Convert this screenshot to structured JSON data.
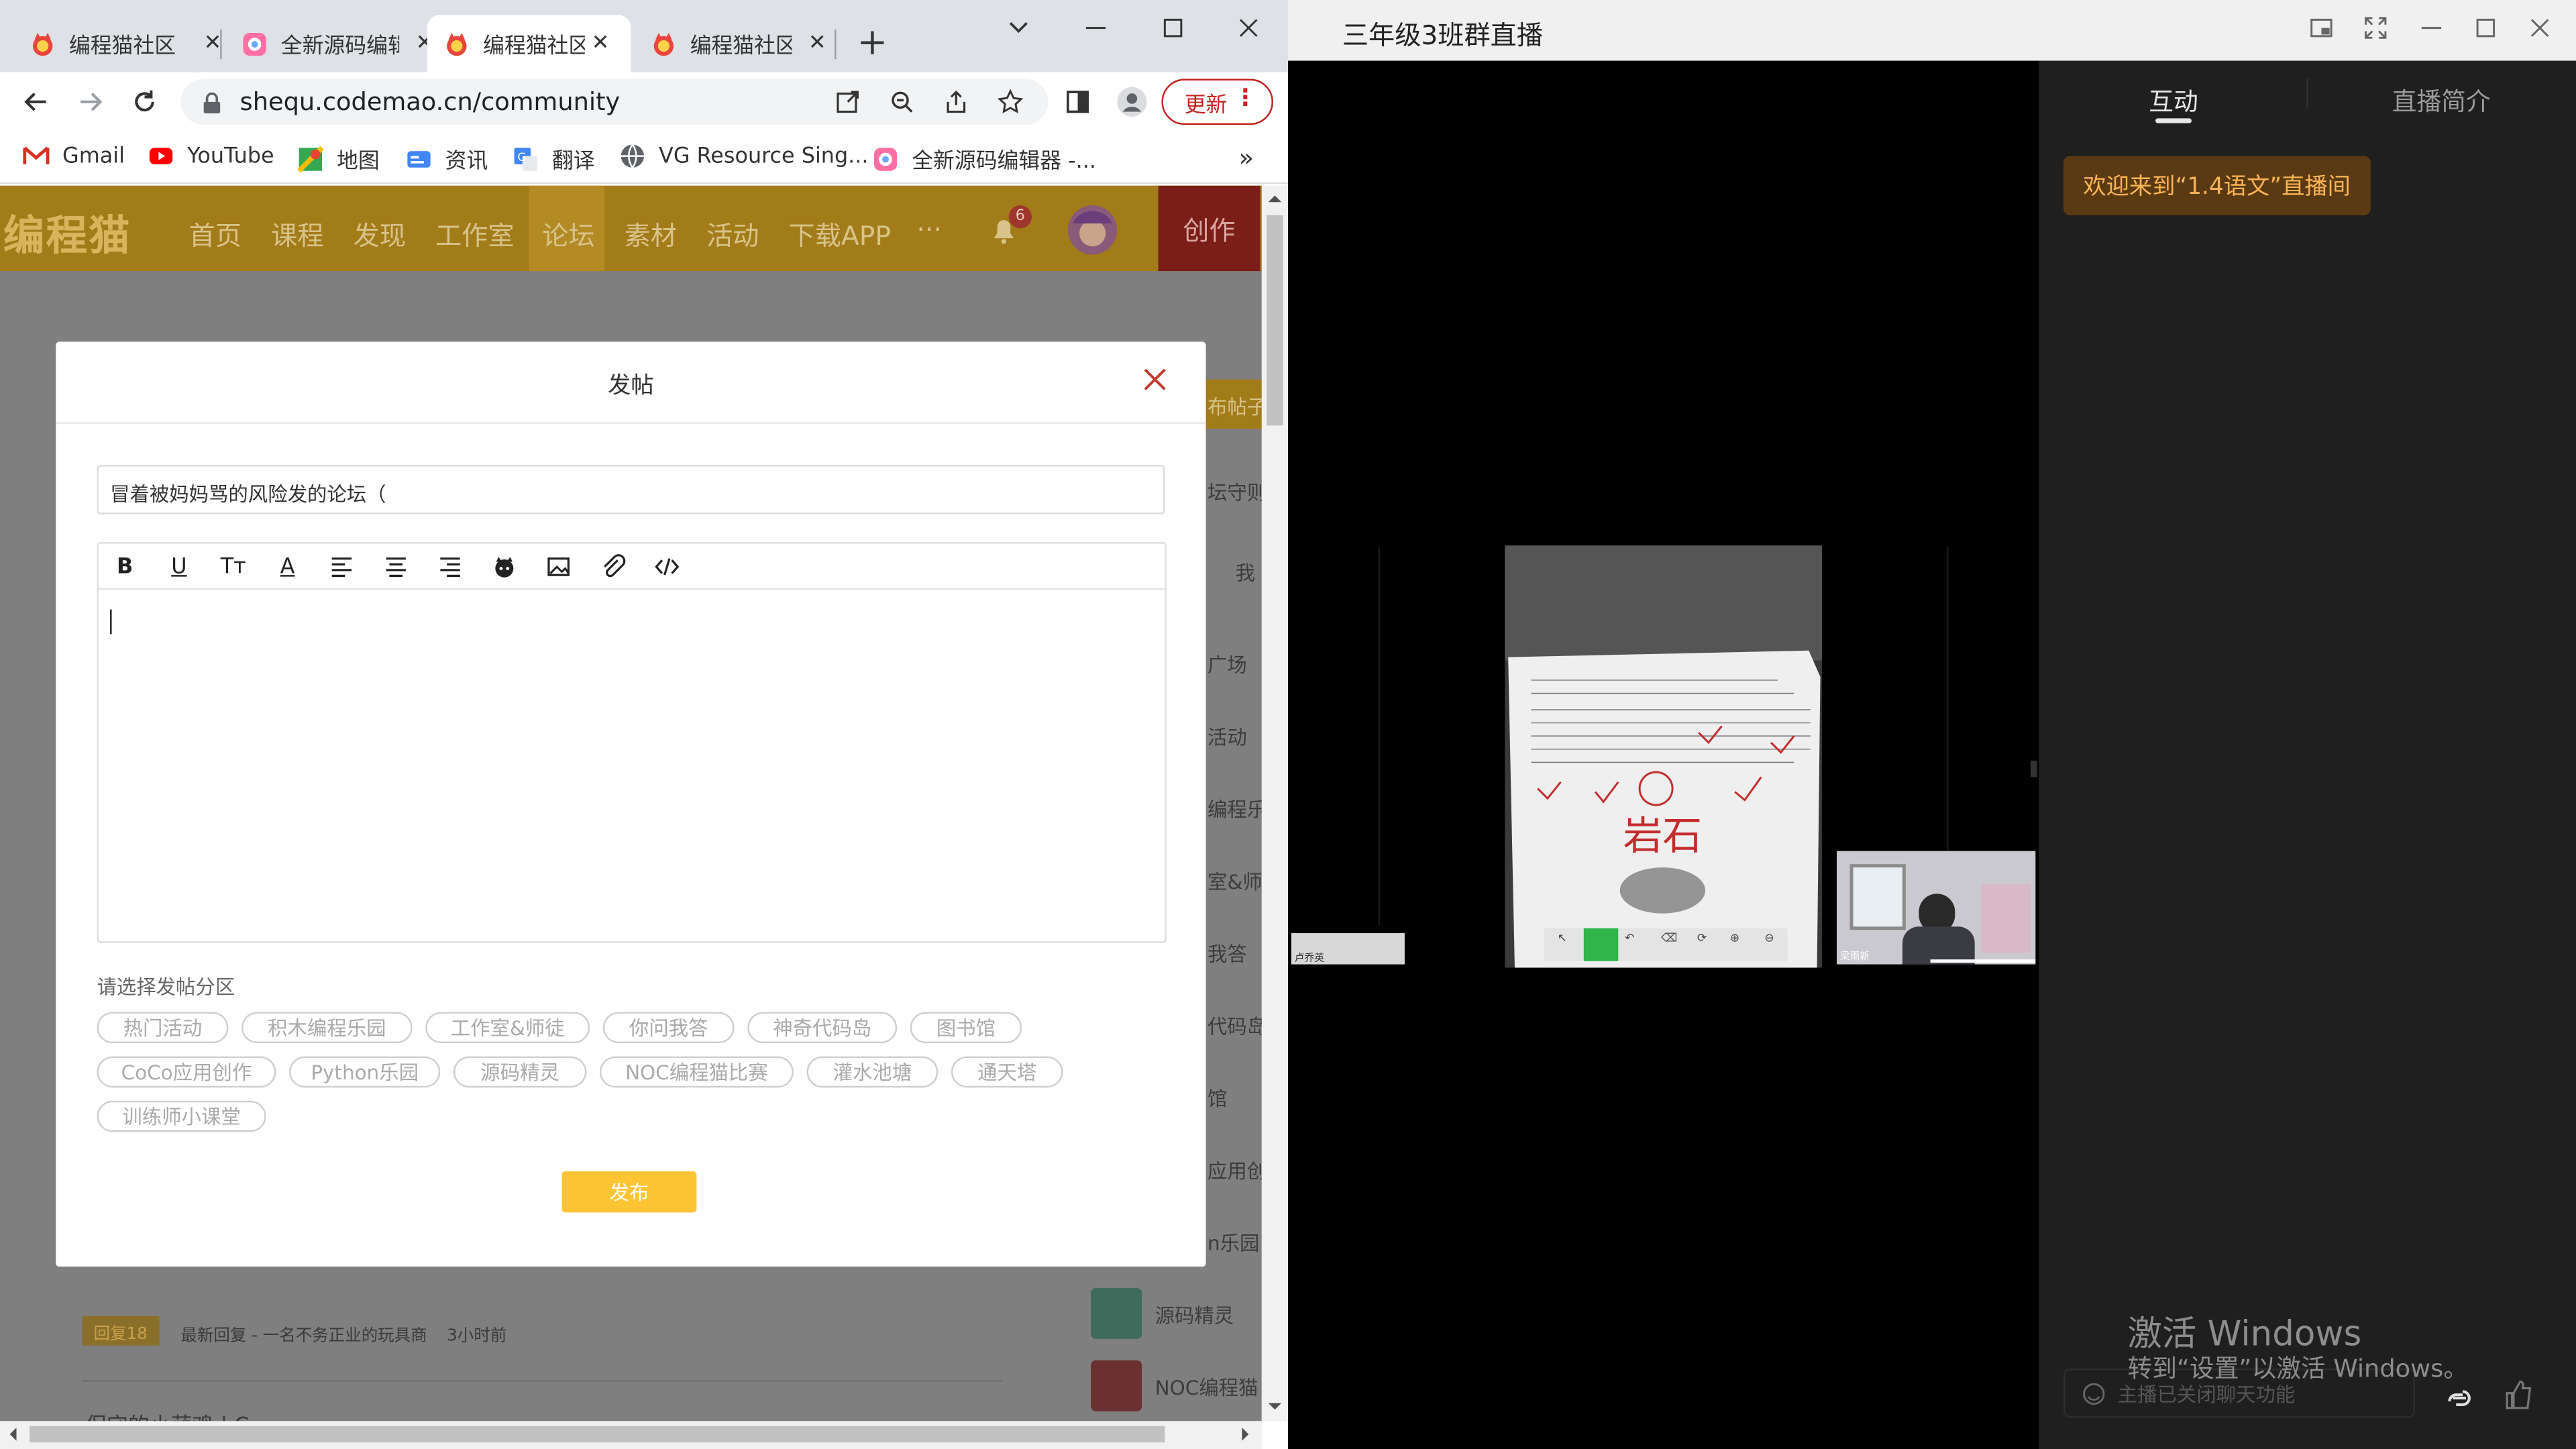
{
  "browser": {
    "tabs": [
      {
        "title": "编程猫社区",
        "active": false,
        "icon": "codemao-favicon"
      },
      {
        "title": "全新源码编辑器",
        "active": false,
        "icon": "editor-favicon"
      },
      {
        "title": "编程猫社区",
        "active": true,
        "icon": "codemao-favicon"
      },
      {
        "title": "编程猫社区",
        "active": false,
        "icon": "codemao-favicon"
      }
    ],
    "url": "sheq u.codemao.cn/community",
    "update_label": "更新",
    "bookmarks": [
      {
        "label": "Gmail",
        "icon": "gmail-icon"
      },
      {
        "label": "YouTube",
        "icon": "youtube-icon"
      },
      {
        "label": "地图",
        "icon": "maps-icon"
      },
      {
        "label": "资讯",
        "icon": "news-icon"
      },
      {
        "label": "翻译",
        "icon": "translate-icon"
      },
      {
        "label": "VG Resource Sing...",
        "icon": "globe-icon"
      },
      {
        "label": "全新源码编辑器 -...",
        "icon": "editor-favicon"
      }
    ],
    "more_bookmarks": "»"
  },
  "site": {
    "logo": "编程猫",
    "nav": [
      "首页",
      "课程",
      "发现",
      "工作室",
      "论坛",
      "素材",
      "活动",
      "下载APP",
      "···"
    ],
    "notification_count": "6",
    "create_label": "创作",
    "side_items": [
      "布帖子",
      "坛守则 >",
      "我",
      "广场",
      "活动",
      "编程乐园",
      "室&师徒",
      "我答",
      "代码岛",
      "馆",
      "应用创",
      "n乐园",
      "源码精灵",
      "NOC编程猫"
    ],
    "reply_badge": "回复18",
    "reply_text": "最新回复 - 一名不务正业的玩具商",
    "reply_time": "3小时前",
    "author_fragment": "保守的小萌鸡 | C"
  },
  "dialog": {
    "title": "发帖",
    "title_value": "冒着被妈妈骂的风险发的论坛（",
    "toolbar": [
      "bold-icon",
      "underline-icon",
      "text-size-icon",
      "font-color-icon",
      "align-left-icon",
      "align-center-icon",
      "align-right-icon",
      "emoji-cat-icon",
      "image-icon",
      "attachment-icon",
      "code-icon"
    ],
    "category_label": "请选择发帖分区",
    "categories": [
      "热门活动",
      "积木编程乐园",
      "工作室&师徒",
      "你问我答",
      "神奇代码岛",
      "图书馆",
      "CoCo应用创作",
      "Python乐园",
      "源码精灵",
      "NOC编程猫比赛",
      "灌水池塘",
      "通天塔",
      "训练师小课堂"
    ],
    "publish_label": "发布"
  },
  "live": {
    "window_title": "三年级3班群直播",
    "tabs": [
      "互动",
      "直播简介"
    ],
    "welcome": "欢迎来到“1.4语文”直播间",
    "chat_placeholder": "主播已关闭聊天功能",
    "watermark_title": "激活 Windows",
    "watermark_sub": "转到“设置”以激活 Windows。",
    "worksheet_handwriting": "岩石",
    "teacher_label": "卢乔英",
    "student_label": "梁雨新"
  }
}
